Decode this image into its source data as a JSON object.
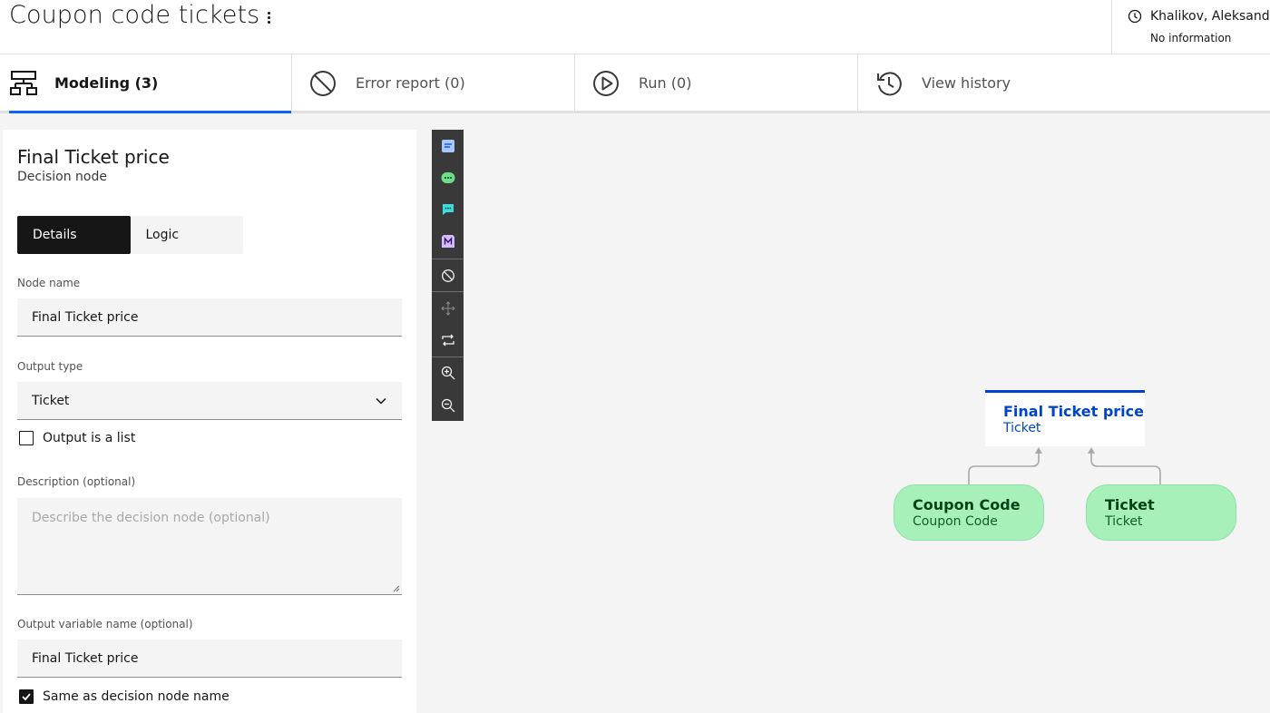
{
  "header": {
    "title": "Coupon code tickets",
    "user_name": "Khalikov, Aleksandr",
    "user_status": "No information"
  },
  "tabs": [
    {
      "label": "Modeling (3)",
      "icon": "decision-model-icon",
      "active": true
    },
    {
      "label": "Error report (0)",
      "icon": "error-prohibit-icon",
      "active": false
    },
    {
      "label": "Run (0)",
      "icon": "play-circle-icon",
      "active": false
    },
    {
      "label": "View history",
      "icon": "history-icon",
      "active": false
    }
  ],
  "panel": {
    "title": "Final Ticket price",
    "subtitle": "Decision node",
    "switcher": {
      "details": "Details",
      "logic": "Logic"
    },
    "node_name_label": "Node name",
    "node_name_value": "Final Ticket price",
    "output_type_label": "Output type",
    "output_type_value": "Ticket",
    "output_list_label": "Output is a list",
    "output_list_checked": false,
    "description_label": "Description (optional)",
    "description_placeholder": "Describe the decision node (optional)",
    "output_var_label": "Output variable name (optional)",
    "output_var_value": "Final Ticket price",
    "same_as_label": "Same as decision node name",
    "same_as_checked": true
  },
  "toolbar": {
    "items": [
      "note-icon",
      "input-node-icon",
      "comment-icon",
      "function-icon",
      "prohibit-icon",
      "move-icon",
      "arrange-icon",
      "zoom-in-icon",
      "zoom-out-icon"
    ]
  },
  "diagram": {
    "decision": {
      "title": "Final Ticket price",
      "subtitle": "Ticket"
    },
    "inputs": [
      {
        "title": "Coupon Code",
        "subtitle": "Coupon Code"
      },
      {
        "title": "Ticket",
        "subtitle": "Ticket"
      }
    ],
    "colors": {
      "decision_accent": "#0043ce",
      "input_fill": "#a7f0ba",
      "active_tab": "#0f62fe"
    }
  }
}
